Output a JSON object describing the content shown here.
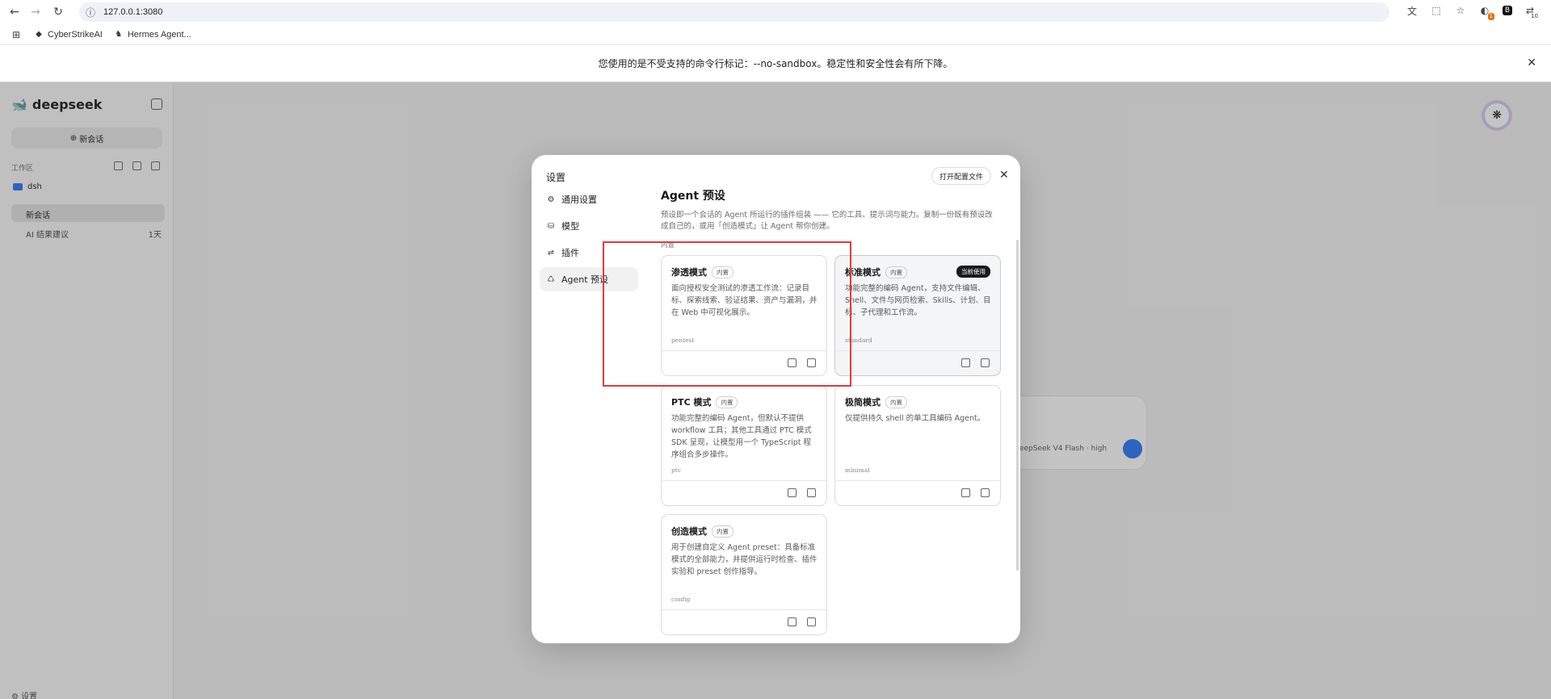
{
  "browser": {
    "url": "127.0.0.1:3080",
    "bookmarks": [
      {
        "label": "CyberStrikeAI"
      },
      {
        "label": "Hermes Agent..."
      }
    ],
    "extension_badge_1": "1",
    "extension_badge_2": "10",
    "infobar_text": "您使用的是不受支持的命令行标记：--no-sandbox。稳定性和安全性会有所下降。"
  },
  "app": {
    "brand": "deepseek",
    "new_chat": "新会话",
    "workspace_label": "工作区",
    "folder": "dsh",
    "active_chat": "新会话",
    "chat_item": "AI 结果建议",
    "chat_item_count": "1天",
    "bottom_label": "设置",
    "model_label": "DeepSeek V4 Flash · high"
  },
  "modal": {
    "title": "设置",
    "open_config": "打开配置文件",
    "nav": [
      {
        "label": "通用设置",
        "icon": "gear-icon"
      },
      {
        "label": "模型",
        "icon": "database-icon"
      },
      {
        "label": "插件",
        "icon": "sliders-icon"
      },
      {
        "label": "Agent 预设",
        "icon": "recycle-icon"
      }
    ],
    "heading": "Agent 预设",
    "description": "预设即一个会话的 Agent 所运行的插件组装 —— 它的工具、提示词与能力。复制一份既有预设改成自己的，或用「创造模式」让 Agent 帮你创建。",
    "section": "内置",
    "cards": [
      {
        "name": "渗透模式",
        "tag": "内置",
        "desc": "面向授权安全测试的渗透工作流：记录目标、探索线索、验证结果、资产与漏洞，并在 Web 中可视化展示。",
        "slug": "pentest",
        "current": ""
      },
      {
        "name": "标准模式",
        "tag": "内置",
        "desc": "功能完整的编码 Agent，支持文件编辑、Shell、文件与网页检索、Skills、计划、目标、子代理和工作流。",
        "slug": "standard",
        "current": "当前使用"
      },
      {
        "name": "PTC 模式",
        "tag": "内置",
        "desc": "功能完整的编码 Agent，但默认不提供 workflow 工具；其他工具通过 PTC 模式 SDK 呈现，让模型用一个 TypeScript 程序组合多步操作。",
        "slug": "ptc",
        "current": ""
      },
      {
        "name": "极简模式",
        "tag": "内置",
        "desc": "仅提供持久 shell 的单工具编码 Agent。",
        "slug": "minimal",
        "current": ""
      },
      {
        "name": "创造模式",
        "tag": "内置",
        "desc": "用于创建自定义 Agent preset：具备标准模式的全部能力，并提供运行时检查、插件实验和 preset 创作指导。",
        "slug": "config",
        "current": ""
      }
    ]
  },
  "colors": {
    "accent": "#3b82f6",
    "highlight": "#e23b3b",
    "current_badge": "#1a1a1a"
  }
}
